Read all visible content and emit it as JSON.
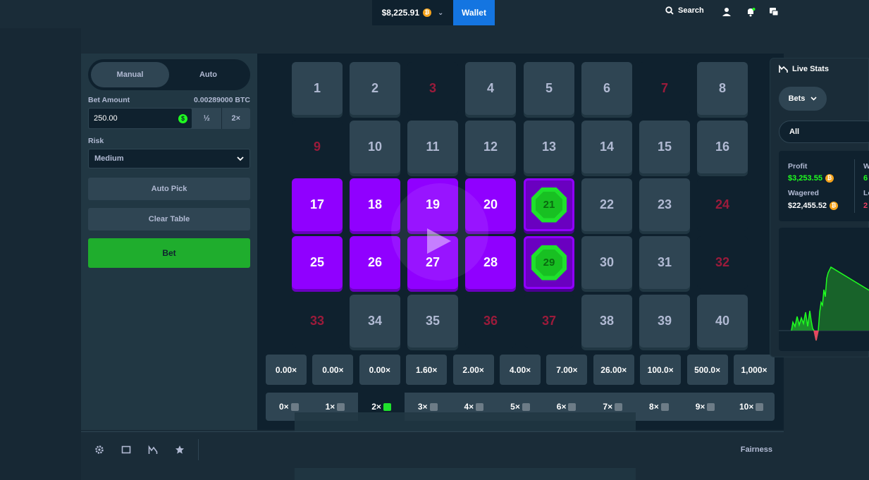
{
  "topbar": {
    "balance": "$8,225.91",
    "wallet_label": "Wallet",
    "search_label": "Search"
  },
  "left_panel": {
    "modes": [
      "Manual",
      "Auto"
    ],
    "active_mode": "Manual",
    "bet_amount_label": "Bet Amount",
    "bet_amount_btc": "0.00289000 BTC",
    "bet_value": "250.00",
    "half_label": "½",
    "double_label": "2×",
    "risk_label": "Risk",
    "risk_value": "Medium",
    "auto_pick_label": "Auto Pick",
    "clear_table_label": "Clear Table",
    "bet_label": "Bet"
  },
  "board": {
    "tiles": [
      {
        "n": "1",
        "state": "normal"
      },
      {
        "n": "2",
        "state": "normal"
      },
      {
        "n": "3",
        "state": "empty"
      },
      {
        "n": "4",
        "state": "normal"
      },
      {
        "n": "5",
        "state": "normal"
      },
      {
        "n": "6",
        "state": "normal"
      },
      {
        "n": "7",
        "state": "empty"
      },
      {
        "n": "8",
        "state": "normal"
      },
      {
        "n": "9",
        "state": "empty"
      },
      {
        "n": "10",
        "state": "normal"
      },
      {
        "n": "11",
        "state": "normal"
      },
      {
        "n": "12",
        "state": "normal"
      },
      {
        "n": "13",
        "state": "normal"
      },
      {
        "n": "14",
        "state": "normal"
      },
      {
        "n": "15",
        "state": "normal"
      },
      {
        "n": "16",
        "state": "normal"
      },
      {
        "n": "17",
        "state": "picked"
      },
      {
        "n": "18",
        "state": "picked"
      },
      {
        "n": "19",
        "state": "picked"
      },
      {
        "n": "20",
        "state": "picked"
      },
      {
        "n": "21",
        "state": "hit"
      },
      {
        "n": "22",
        "state": "normal"
      },
      {
        "n": "23",
        "state": "normal"
      },
      {
        "n": "24",
        "state": "empty"
      },
      {
        "n": "25",
        "state": "picked"
      },
      {
        "n": "26",
        "state": "picked"
      },
      {
        "n": "27",
        "state": "picked"
      },
      {
        "n": "28",
        "state": "picked"
      },
      {
        "n": "29",
        "state": "hit"
      },
      {
        "n": "30",
        "state": "normal"
      },
      {
        "n": "31",
        "state": "normal"
      },
      {
        "n": "32",
        "state": "empty"
      },
      {
        "n": "33",
        "state": "empty"
      },
      {
        "n": "34",
        "state": "normal"
      },
      {
        "n": "35",
        "state": "normal"
      },
      {
        "n": "36",
        "state": "empty"
      },
      {
        "n": "37",
        "state": "empty"
      },
      {
        "n": "38",
        "state": "normal"
      },
      {
        "n": "39",
        "state": "normal"
      },
      {
        "n": "40",
        "state": "normal"
      }
    ],
    "payouts": [
      "0.00×",
      "0.00×",
      "0.00×",
      "1.60×",
      "2.00×",
      "4.00×",
      "7.00×",
      "26.00×",
      "100.0×",
      "500.0×",
      "1,000×"
    ],
    "hits": [
      "0×",
      "1×",
      "2×",
      "3×",
      "4×",
      "5×",
      "6×",
      "7×",
      "8×",
      "9×",
      "10×"
    ],
    "active_hit": "2×"
  },
  "bottom": {
    "fairness_label": "Fairness"
  },
  "live_stats": {
    "title": "Live Stats",
    "bets_dropdown": "Bets",
    "filter": "All",
    "profit_label": "Profit",
    "profit_value": "$3,253.55",
    "wagered_label": "Wagered",
    "wagered_value": "$22,455.52",
    "cut_label_1": "W",
    "cut_value_1": "6",
    "cut_label_2": "Lo",
    "cut_value_2": "2",
    "colors": {
      "profit": "#1fff20",
      "loss": "#ed4163"
    }
  },
  "colors": {
    "picked": "#9000ff",
    "gem": "#1fe02c",
    "bet_button": "#1fad2d",
    "wallet": "#1475e1"
  }
}
